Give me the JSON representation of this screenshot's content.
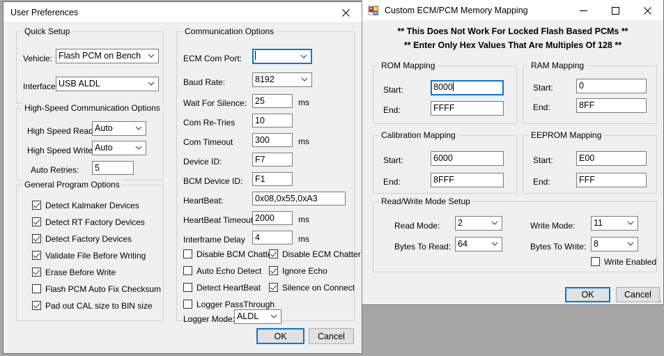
{
  "desktop": {
    "background_color": "#a6a6a6"
  },
  "user_preferences": {
    "title": "User Preferences",
    "close_icon": "close-icon",
    "quick_setup": {
      "legend": "Quick Setup",
      "vehicle_label": "Vehicle:",
      "vehicle_value": "Flash PCM on Bench",
      "interface_label": "Interface:",
      "interface_value": "USB ALDL"
    },
    "high_speed": {
      "legend": "High-Speed Communication Options",
      "read_label": "High Speed Read",
      "read_value": "Auto",
      "write_label": "High Speed Write",
      "write_value": "Auto",
      "retries_label": "Auto Retries:",
      "retries_value": "5"
    },
    "general_options": {
      "legend": "General Program Options",
      "items": [
        {
          "label": "Detect Kalmaker Devices",
          "checked": true
        },
        {
          "label": "Detect RT Factory Devices",
          "checked": true
        },
        {
          "label": "Detect Factory Devices",
          "checked": true
        },
        {
          "label": "Validate File Before Writing",
          "checked": true
        },
        {
          "label": "Erase Before Write",
          "checked": true
        },
        {
          "label": "Flash PCM Auto Fix Checksum",
          "checked": false
        },
        {
          "label": "Pad out CAL size to BIN size",
          "checked": true
        }
      ]
    },
    "communication": {
      "legend": "Communication Options",
      "ecm_com_port_label": "ECM Com Port:",
      "ecm_com_port_value": "",
      "baud_rate_label": "Baud Rate:",
      "baud_rate_value": "8192",
      "wait_for_silence_label": "Wait For Silence:",
      "wait_for_silence_value": "25",
      "wait_for_silence_unit": "ms",
      "com_retries_label": "Com Re-Tries",
      "com_retries_value": "10",
      "com_timeout_label": "Com Timeout",
      "com_timeout_value": "300",
      "com_timeout_unit": "ms",
      "device_id_label": "Device ID:",
      "device_id_value": "F7",
      "bcm_device_id_label": "BCM Device ID:",
      "bcm_device_id_value": "F1",
      "heartbeat_label": "HeartBeat:",
      "heartbeat_value": "0x08,0x55,0xA3",
      "heartbeat_timeout_label": "HeartBeat Timeout",
      "heartbeat_timeout_value": "2000",
      "heartbeat_timeout_unit": "ms",
      "interframe_delay_label": "Interframe Delay",
      "interframe_delay_value": "4",
      "interframe_delay_unit": "ms",
      "checkboxes": [
        {
          "label": "Disable BCM Chatter",
          "checked": false
        },
        {
          "label": "Disable ECM Chatter",
          "checked": true
        },
        {
          "label": "Auto Echo Detect",
          "checked": false
        },
        {
          "label": "Ignore Echo",
          "checked": true
        },
        {
          "label": "Detect HeartBeat",
          "checked": false
        },
        {
          "label": "Silence on Connect",
          "checked": true
        },
        {
          "label": "Logger PassThrough",
          "checked": false
        }
      ],
      "logger_mode_label": "Logger Mode:",
      "logger_mode_value": "ALDL"
    },
    "ok_label": "OK",
    "cancel_label": "Cancel"
  },
  "memory_mapping": {
    "title": "Custom ECM/PCM Memory Mapping",
    "app_icon": "vb-form-icon",
    "minimize_icon": "minimize-icon",
    "maximize_icon": "maximize-icon",
    "close_icon": "close-icon",
    "header_line1": "** This Does Not Work For Locked Flash Based PCMs **",
    "header_line2": "** Enter Only Hex Values That Are Multiples Of 128 **",
    "rom": {
      "legend": "ROM Mapping",
      "start_label": "Start:",
      "start_value": "8000",
      "end_label": "End:",
      "end_value": "FFFF"
    },
    "ram": {
      "legend": "RAM Mapping",
      "start_label": "Start:",
      "start_value": "0",
      "end_label": "End:",
      "end_value": "8FF"
    },
    "calibration": {
      "legend": "Calibration Mapping",
      "start_label": "Start:",
      "start_value": "6000",
      "end_label": "End:",
      "end_value": "8FFF"
    },
    "eeprom": {
      "legend": "EEPROM Mapping",
      "start_label": "Start:",
      "start_value": "E00",
      "end_label": "End:",
      "end_value": "FFF"
    },
    "rw_setup": {
      "legend": "Read/Write Mode Setup",
      "read_mode_label": "Read Mode:",
      "read_mode_value": "2",
      "bytes_to_read_label": "Bytes To Read:",
      "bytes_to_read_value": "64",
      "write_mode_label": "Write Mode:",
      "write_mode_value": "11",
      "bytes_to_write_label": "Bytes To Write:",
      "bytes_to_write_value": "8",
      "write_enabled_label": "Write Enabled",
      "write_enabled_checked": false
    },
    "ok_label": "OK",
    "cancel_label": "Cancel"
  },
  "colors": {
    "accent": "#0078d7",
    "window_bg": "#f0f0f0",
    "field_bg": "#ffffff",
    "desktop": "#a6a6a6"
  }
}
